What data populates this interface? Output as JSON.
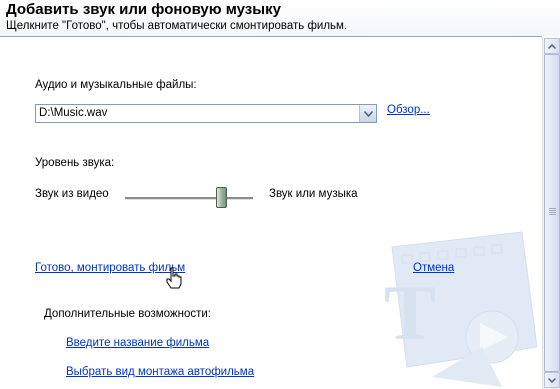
{
  "header": {
    "title": "Добавить звук или фоновую музыку",
    "subtitle": "Щелкните \"Готово\", чтобы автоматически смонтировать фильм."
  },
  "audio": {
    "label": "Аудио и музыкальные файлы:",
    "file_value": "D:\\Music.wav",
    "browse_link": "Обзор..."
  },
  "volume": {
    "label": "Уровень звука:",
    "left_label": "Звук из видео",
    "right_label": "Звук или музыка",
    "slider_level": 0.78
  },
  "actions": {
    "done_link": "Готово, монтировать фильм",
    "cancel_link": "Отмена"
  },
  "extras": {
    "label": "Дополнительные возможности:",
    "links": [
      "Введите название фильма",
      "Выбрать вид монтажа автофильма"
    ]
  },
  "colors": {
    "link": "#0033cc",
    "accent": "#1f4fa3"
  },
  "icons": {
    "cursor": "hand-pointer-icon",
    "watermark": "film-reel-watermark-icon"
  }
}
